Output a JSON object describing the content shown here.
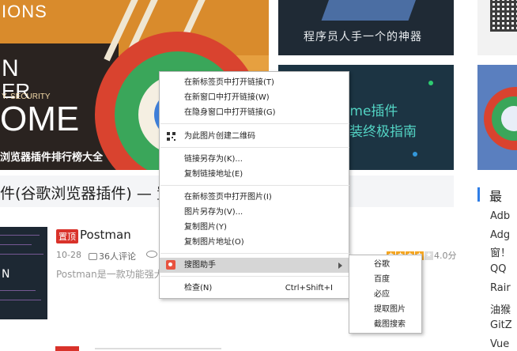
{
  "hero": {
    "line_ions": "IONS",
    "line_n": "N",
    "line_er": "ER",
    "line_security": "Y. SECURITY",
    "line_ome": "OME",
    "rank_title": "浏览器插件排行榜大全"
  },
  "cards": {
    "card_a_text": "程序员人手一个的神器",
    "card_b_line1": "ome插件",
    "card_b_line2": "装终极指南"
  },
  "article": {
    "title": "件(谷歌浏览器插件) — 置"
  },
  "post": {
    "thumb_text": "N",
    "tag": "置顶",
    "title": "Postman",
    "date": "10-28",
    "comments": "36人评论",
    "description": "Postman是一款功能强大",
    "rating": 4.0,
    "score": "4.0分"
  },
  "sidebar": {
    "heading": "最",
    "items": [
      "Adb",
      "Adg",
      "窗！",
      "QQ",
      "Rair",
      "油猴",
      "GitZ",
      "Vue"
    ]
  },
  "context_menu": {
    "open_link_new_tab": "在新标签页中打开链接(T)",
    "open_link_new_window": "在新窗口中打开链接(W)",
    "open_link_incognito": "在隐身窗口中打开链接(G)",
    "create_qr": "为此图片创建二维码",
    "save_link_as": "链接另存为(K)...",
    "copy_link": "复制链接地址(E)",
    "open_image_new_tab": "在新标签页中打开图片(I)",
    "save_image_as": "图片另存为(V)...",
    "copy_image": "复制图片(Y)",
    "copy_image_address": "复制图片地址(O)",
    "image_helper": "搜图助手",
    "inspect": "检查(N)",
    "inspect_shortcut": "Ctrl+Shift+I"
  },
  "submenu": {
    "items": [
      "谷歌",
      "百度",
      "必应",
      "提取图片",
      "截图搜索"
    ]
  }
}
